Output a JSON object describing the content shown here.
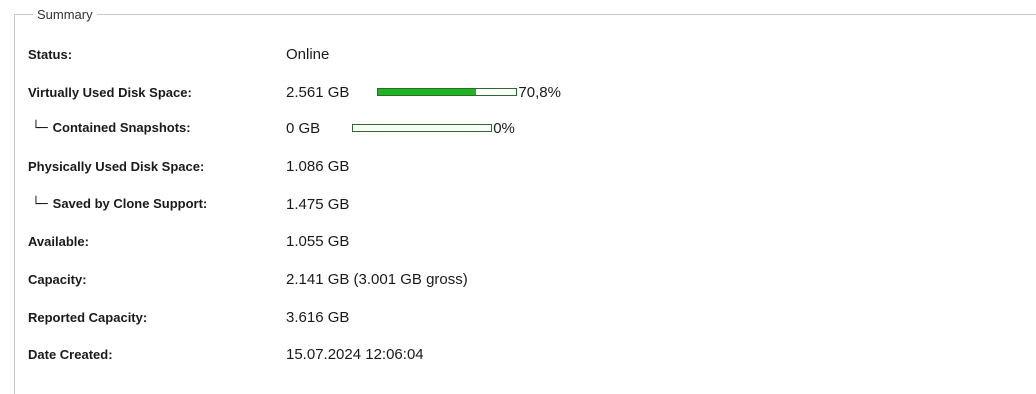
{
  "summary": {
    "legend": "Summary",
    "rows": [
      {
        "label": "Status:",
        "value": "Online"
      },
      {
        "label": "Virtually Used Disk Space:",
        "value": "2.561 GB",
        "percent_label": "70,8%",
        "fill_fraction": 0.708
      },
      {
        "branch": "└─",
        "label": "Contained Snapshots:",
        "value": "0 GB",
        "percent_label": "0%",
        "fill_fraction": 0.0
      },
      {
        "label": "Physically Used Disk Space:",
        "value": "1.086 GB"
      },
      {
        "branch": "└─",
        "label": "Saved by Clone Support:",
        "value": "1.475 GB"
      },
      {
        "label": "Available:",
        "value": "1.055 GB"
      },
      {
        "label": "Capacity:",
        "value": "2.141 GB (3.001 GB gross)"
      },
      {
        "label": "Reported Capacity:",
        "value": "3.616 GB"
      },
      {
        "label": "Date Created:",
        "value": "15.07.2024 12:06:04"
      }
    ]
  },
  "colors": {
    "bar_fill": "#22b322",
    "bar_border": "#2a6a2a"
  }
}
